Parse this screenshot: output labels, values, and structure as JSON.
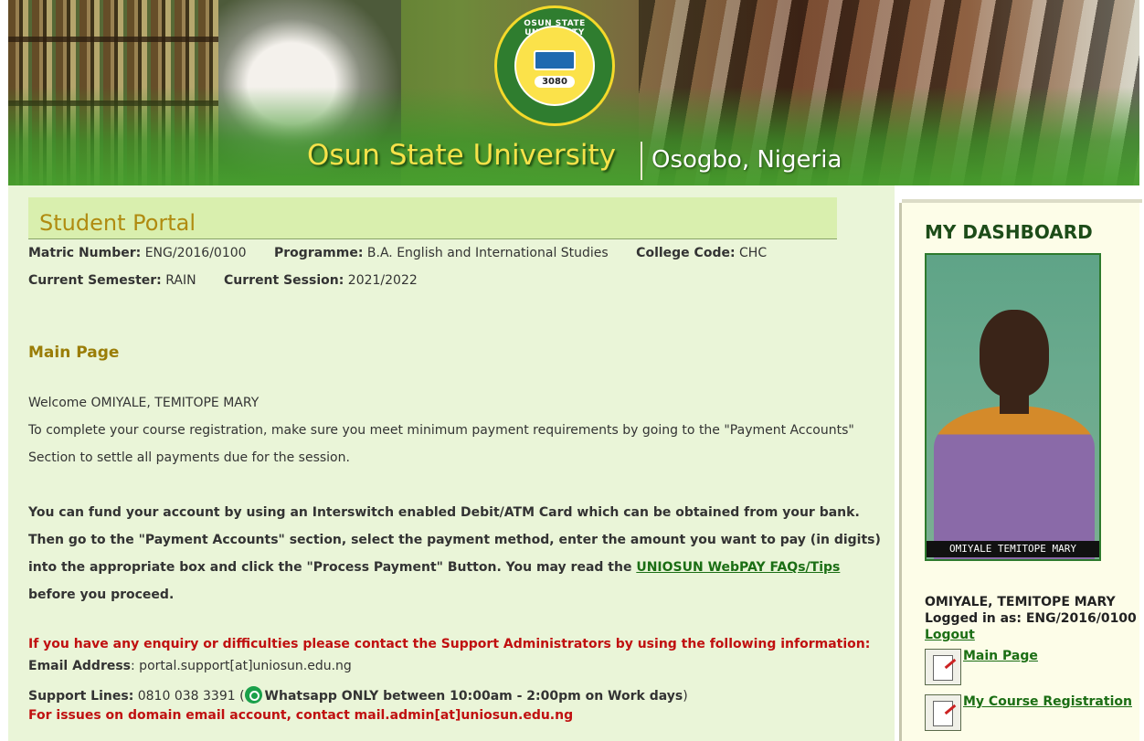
{
  "banner": {
    "university": "Osun State University",
    "location": "Osogbo, Nigeria",
    "logo_ring_text": "OSUN STATE UNIVERSITY",
    "logo_number": "3080"
  },
  "portal": {
    "title": "Student Portal",
    "matric_label": "Matric Number:",
    "matric_value": "ENG/2016/0100",
    "programme_label": "Programme:",
    "programme_value": "B.A. English and International Studies",
    "college_label": "College Code:",
    "college_value": "CHC",
    "semester_label": "Current Semester:",
    "semester_value": "RAIN",
    "session_label": "Current Session:",
    "session_value": "2021/2022"
  },
  "main": {
    "section_title": "Main Page",
    "welcome": "Welcome OMIYALE, TEMITOPE MARY",
    "line1": "To complete your course registration, make sure you meet minimum payment requirements by going to the \"Payment Accounts\"",
    "line2": "Section to settle all payments due for the session.",
    "fund1": "You can fund your account by using an Interswitch enabled Debit/ATM Card which can be obtained from your bank.",
    "fund2": "Then go to the \"Payment Accounts\" section, select the payment method, enter the amount you want to pay (in digits)",
    "fund3": "into the appropriate box and click the \"Process Payment\" Button. You may read the ",
    "fund3_link": "UNIOSUN WebPAY FAQs/Tips",
    "fund4": "before you proceed.",
    "enquiry": "If you have any enquiry or difficulties please contact the Support Administrators by using the following information:",
    "email_label": "Email Address",
    "email_value": ": portal.support[at]uniosun.edu.ng",
    "support_label": "Support Lines:",
    "support_value": " 0810 038 3391 (",
    "whatsapp_text": "Whatsapp ONLY between 10:00am - 2:00pm on Work days",
    "support_close": ")",
    "domain_issue": "For issues on domain email account, contact mail.admin[at]uniosun.edu.ng"
  },
  "sidebar": {
    "title": "MY DASHBOARD",
    "photo_caption": "OMIYALE TEMITOPE MARY",
    "user_name": "OMIYALE, TEMITOPE MARY",
    "logged_in": "Logged in as: ENG/2016/0100",
    "logout": "Logout",
    "links": [
      {
        "label": "Main Page",
        "icon": "document-edit-icon"
      },
      {
        "label": "My Course Registration",
        "icon": "document-edit-icon"
      }
    ]
  }
}
